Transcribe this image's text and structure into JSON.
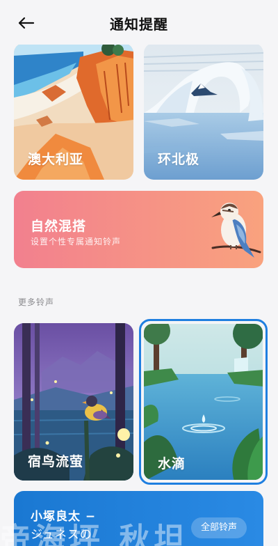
{
  "header": {
    "title": "通知提醒"
  },
  "cards": {
    "australia": {
      "label": "澳大利亚"
    },
    "arctic": {
      "label": "环北极"
    },
    "mix": {
      "title": "自然混搭",
      "subtitle": "设置个性专属通知铃声"
    },
    "fireflies": {
      "label": "宿鸟流萤"
    },
    "water": {
      "label": "水滴"
    }
  },
  "section": {
    "more_label": "更多铃声"
  },
  "artist": {
    "line1": "小塚良太 −",
    "line2": "ジュネスの",
    "background_text": "帝海坪   秋坦",
    "all_button": "全部铃声"
  },
  "colors": {
    "accent": "#1f7fe0"
  },
  "icons": {
    "back": "arrow-left-icon"
  }
}
